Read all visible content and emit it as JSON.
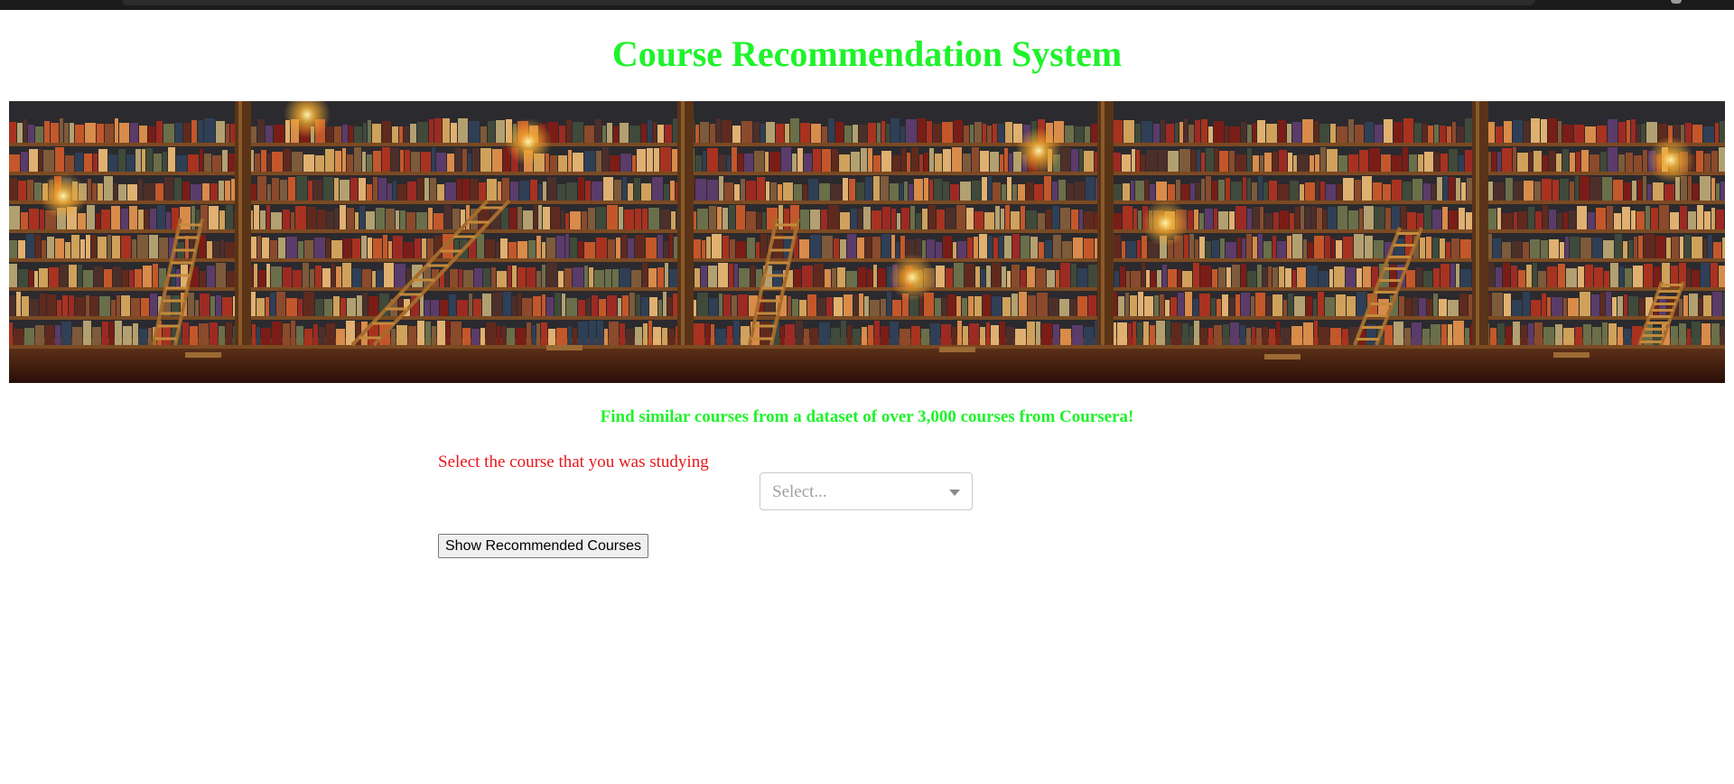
{
  "page": {
    "title": "Course Recommendation System",
    "subtitle": "Find similar courses from a dataset of over 3,000 courses from Coursera!",
    "banner_image": "library bookshelves with ladders and lamps"
  },
  "form": {
    "select_label": "Select the course that you was studying",
    "select_placeholder": "Select...",
    "submit_label": "Show Recommended Courses"
  },
  "colors": {
    "title": "#1ef32a",
    "label": "#e8171b",
    "placeholder": "#a0a0a0"
  },
  "icons": {
    "dropdown": "chevron-down-icon"
  }
}
